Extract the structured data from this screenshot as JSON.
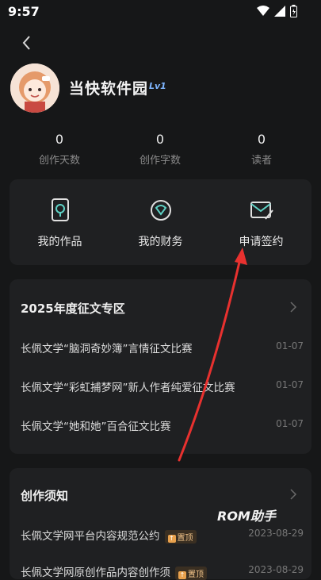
{
  "status": {
    "time": "9:57"
  },
  "profile": {
    "name": "当快软件园",
    "level": "Lv1"
  },
  "stats": [
    {
      "value": "0",
      "label": "创作天数"
    },
    {
      "value": "0",
      "label": "创作字数"
    },
    {
      "value": "0",
      "label": "读者"
    }
  ],
  "actions": [
    {
      "label": "我的作品",
      "icon": "works-icon"
    },
    {
      "label": "我的财务",
      "icon": "finance-icon"
    },
    {
      "label": "申请签约",
      "icon": "sign-contract-icon"
    }
  ],
  "contest": {
    "title": "2025年度征文专区",
    "items": [
      {
        "text": "长佩文学“脑洞奇妙簿”言情征文比赛",
        "date": "01-07"
      },
      {
        "text": "长佩文学“彩虹捕梦网”新人作者纯爱征文比赛",
        "date": "01-07"
      },
      {
        "text": "长佩文学“她和她”百合征文比赛",
        "date": "01-07"
      }
    ]
  },
  "notice": {
    "title": "创作须知",
    "items": [
      {
        "text": "长佩文学网平台内容规范公约",
        "badge": "置顶",
        "date": "2023-08-29"
      },
      {
        "text": "长佩文学网原创作品内容创作须",
        "badge": "置顶",
        "date": "2023-08-29"
      }
    ]
  },
  "watermark": "ROM助手",
  "colors": {
    "background": "#161718",
    "card": "#1f2022",
    "accent_arrow": "#e8312f",
    "level_badge": "#7fb6ff"
  }
}
